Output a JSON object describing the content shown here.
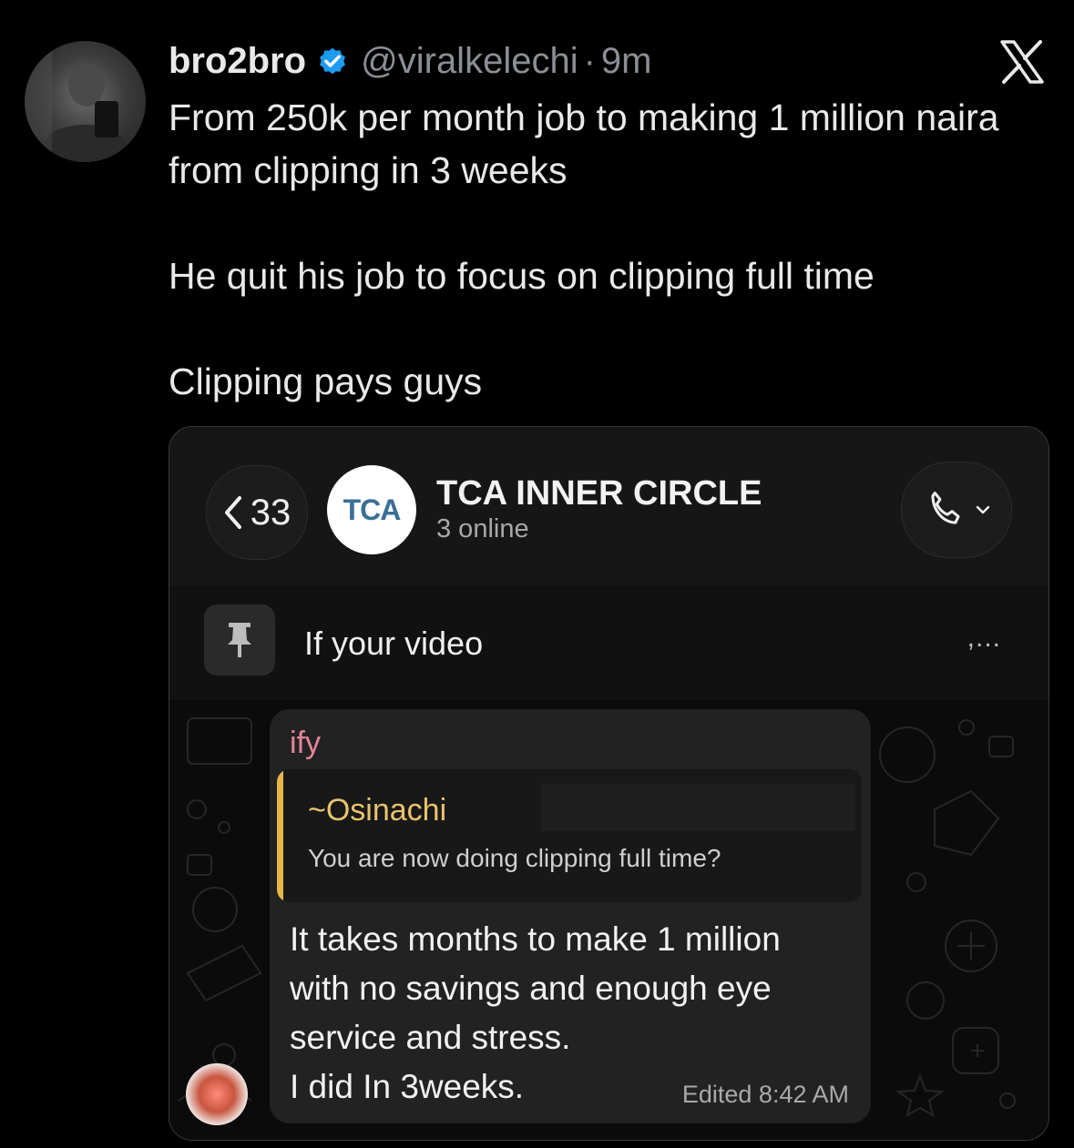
{
  "tweet": {
    "author_name": "bro2bro",
    "handle": "@viralkelechi",
    "separator": "·",
    "time": "9m",
    "lines": [
      "From 250k per month job to making 1 million naira from clipping in 3 weeks",
      "He quit his job to focus on clipping full time",
      "Clipping pays guys"
    ],
    "icons": {
      "verified": "verified-badge-icon",
      "brand": "x-logo-icon"
    },
    "colors": {
      "verified": "#1d9bf0",
      "muted": "#8b8f94"
    }
  },
  "screenshot": {
    "back_count": "33",
    "group_logo_text": "TCA",
    "group_name": "TCA INNER CIRCLE",
    "group_status": "3 online",
    "pinned_text": "If your video",
    "pinned_more": ",...",
    "message": {
      "sender": "ify",
      "reply_name": "~Osinachi",
      "reply_text": "You are now doing clipping full time?",
      "lines": [
        "It takes months to make 1 million",
        "with no savings and enough eye",
        "service and stress.",
        "I did In 3weeks."
      ],
      "meta": "Edited 8:42 AM"
    },
    "colors": {
      "sender": "#e4869a",
      "reply_name": "#e8c36e",
      "reply_bar": "#e8b64a"
    }
  }
}
